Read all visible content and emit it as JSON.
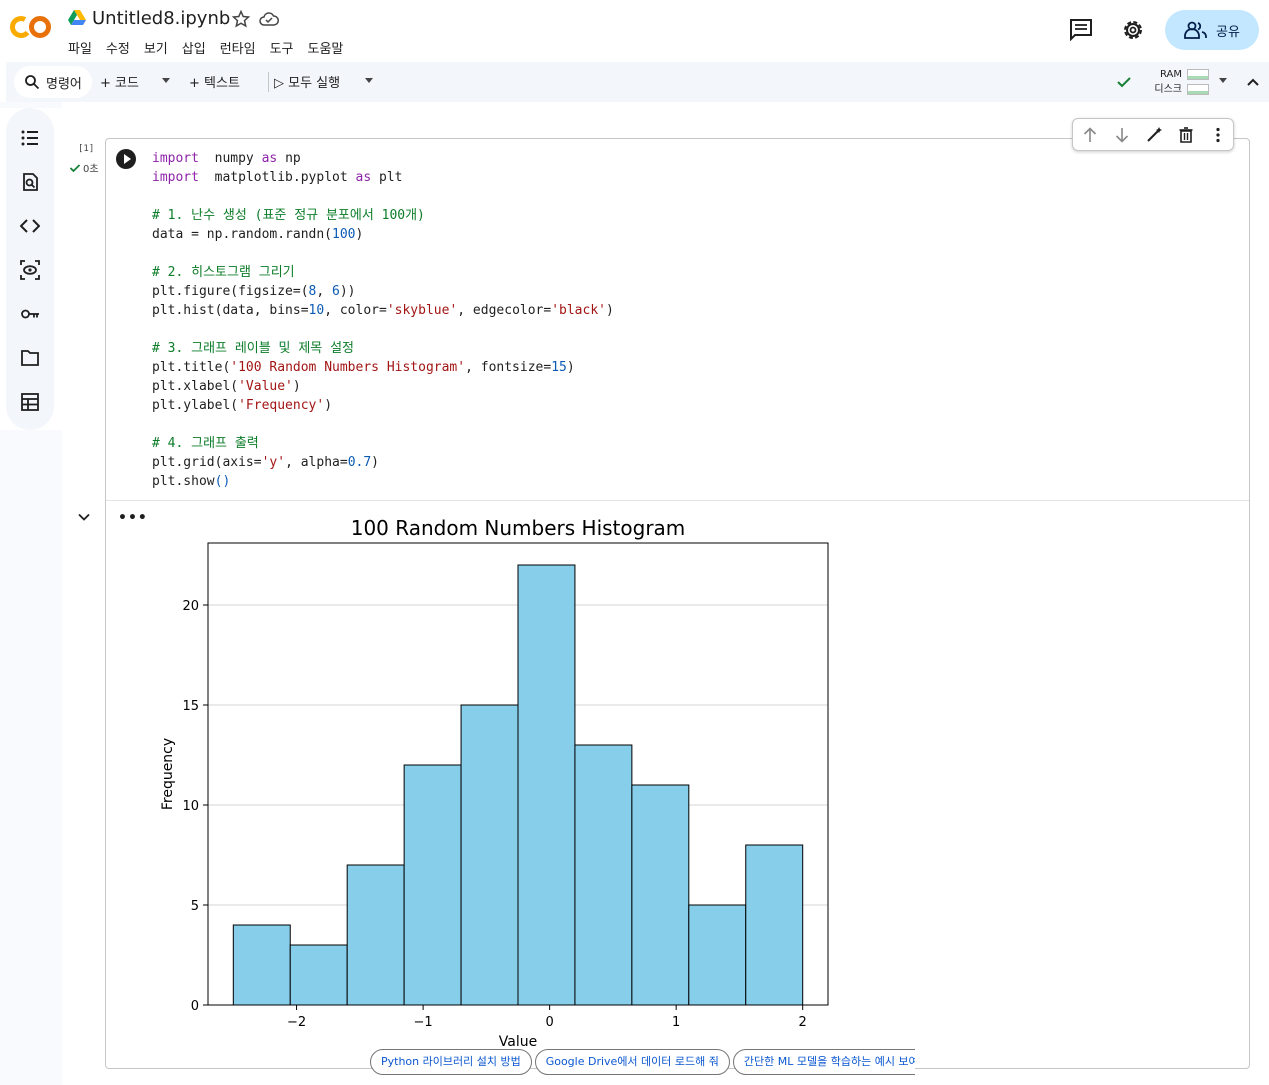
{
  "header": {
    "logo_text": "CO",
    "doc_title": "Untitled8.ipynb",
    "menu": [
      "파일",
      "수정",
      "보기",
      "삽입",
      "런타임",
      "도구",
      "도움말"
    ],
    "share_label": "공유",
    "icons": [
      "comment-icon",
      "settings-gear-icon",
      "people-icon"
    ]
  },
  "toolbar": {
    "command_label": "명령어",
    "add_code_label": "+ 코드",
    "add_text_label": "+ 텍스트",
    "run_all_label": "▷ 모두 실행",
    "ram_label": "RAM",
    "disk_label": "디스크"
  },
  "sidebar": {
    "items": [
      "table-of-contents-icon",
      "find-replace-icon",
      "code-snippets-icon",
      "variables-icon",
      "secrets-key-icon",
      "files-folder-icon",
      "data-table-icon"
    ]
  },
  "cell": {
    "exec_count": "[1]",
    "exec_time": "0초",
    "code_lines": [
      [
        [
          "kw",
          "import"
        ],
        [
          "",
          "  numpy "
        ],
        [
          "kw",
          "as"
        ],
        [
          "",
          " np"
        ]
      ],
      [
        [
          "kw",
          "import"
        ],
        [
          "",
          "  matplotlib.pyplot "
        ],
        [
          "kw",
          "as"
        ],
        [
          "",
          " plt"
        ]
      ],
      [],
      [
        [
          "cm",
          "# 1. 난수 생성 (표준 정규 분포에서 100개)"
        ]
      ],
      [
        [
          "",
          "data = np.random.randn("
        ],
        [
          "num",
          "100"
        ],
        [
          "",
          ")"
        ]
      ],
      [],
      [
        [
          "cm",
          "# 2. 히스토그램 그리기"
        ]
      ],
      [
        [
          "",
          "plt.figure(figsize=("
        ],
        [
          "num",
          "8"
        ],
        [
          "",
          ", "
        ],
        [
          "num",
          "6"
        ],
        [
          "",
          "))"
        ]
      ],
      [
        [
          "",
          "plt.hist(data, bins="
        ],
        [
          "num",
          "10"
        ],
        [
          "",
          ", color="
        ],
        [
          "str",
          "'skyblue'"
        ],
        [
          "",
          ", edgecolor="
        ],
        [
          "str",
          "'black'"
        ],
        [
          "",
          ")"
        ]
      ],
      [],
      [
        [
          "cm",
          "# 3. 그래프 레이블 및 제목 설정"
        ]
      ],
      [
        [
          "",
          "plt.title("
        ],
        [
          "str",
          "'100 Random Numbers Histogram'"
        ],
        [
          "",
          ", fontsize="
        ],
        [
          "num",
          "15"
        ],
        [
          "",
          ")"
        ]
      ],
      [
        [
          "",
          "plt.xlabel("
        ],
        [
          "str",
          "'Value'"
        ],
        [
          "",
          ")"
        ]
      ],
      [
        [
          "",
          "plt.ylabel("
        ],
        [
          "str",
          "'Frequency'"
        ],
        [
          "",
          ")"
        ]
      ],
      [],
      [
        [
          "cm",
          "# 4. 그래프 출력"
        ]
      ],
      [
        [
          "",
          "plt.grid(axis="
        ],
        [
          "str",
          "'y'"
        ],
        [
          "",
          ", alpha="
        ],
        [
          "num",
          "0.7"
        ],
        [
          "",
          ")"
        ]
      ],
      [
        [
          "",
          "plt.show"
        ],
        [
          "num",
          "()"
        ]
      ]
    ],
    "output_menu": "•••"
  },
  "chart_data": {
    "type": "bar",
    "title": "100 Random Numbers Histogram",
    "xlabel": "Value",
    "ylabel": "Frequency",
    "bin_edges": [
      -2.5,
      -2.05,
      -1.6,
      -1.15,
      -0.7,
      -0.25,
      0.2,
      0.65,
      1.1,
      1.55,
      2.0
    ],
    "values": [
      4,
      3,
      7,
      12,
      15,
      22,
      13,
      11,
      5,
      8
    ],
    "xlim": [
      -2.7,
      2.2
    ],
    "ylim": [
      0,
      23.1
    ],
    "xticks": [
      -2,
      -1,
      0,
      1,
      2
    ],
    "xtick_labels": [
      "−2",
      "−1",
      "0",
      "1",
      "2"
    ],
    "yticks": [
      0,
      5,
      10,
      15,
      20
    ],
    "bar_color": "#87ceeb",
    "edge_color": "#000000",
    "grid": "y"
  },
  "suggestions": [
    "Python 라이브러리 설치 방법",
    "Google Drive에서 데이터 로드해 줘",
    "간단한 ML 모델을 학습하는 예시 보여"
  ]
}
